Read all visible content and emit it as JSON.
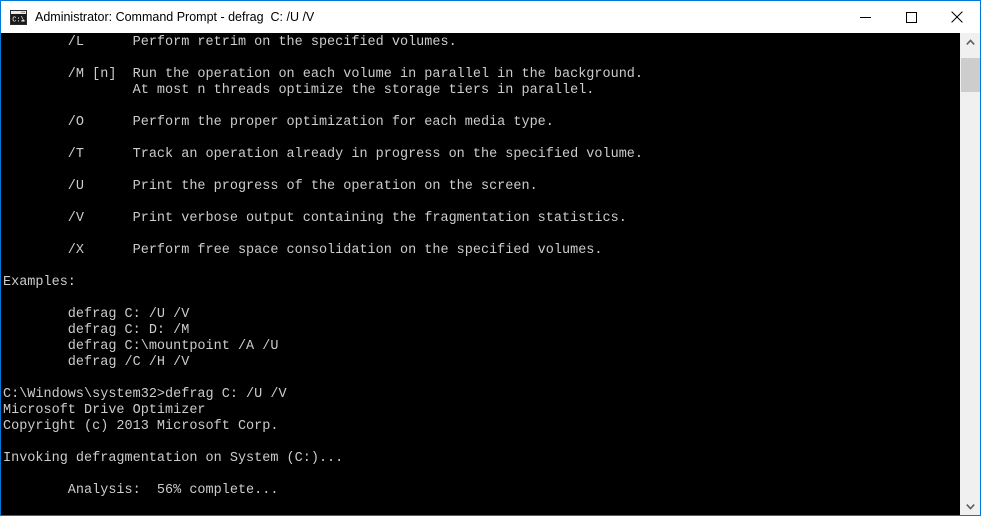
{
  "window": {
    "title": "Administrator: Command Prompt - defrag  C: /U /V",
    "icon_name": "command-prompt-icon",
    "accent_color": "#0078d7",
    "titlebar_background": "#ffffff",
    "console_background": "#000000",
    "console_foreground": "#cccccc"
  },
  "controls": {
    "minimize_glyph": "—",
    "maximize_glyph": "□",
    "close_glyph": "✕",
    "minimize_label": "Minimize",
    "maximize_label": "Maximize",
    "close_label": "Close"
  },
  "scrollbar": {
    "up_glyph": "∧",
    "down_glyph": "∨"
  },
  "console": {
    "lines": [
      "        /L      Perform retrim on the specified volumes.",
      "",
      "        /M [n]  Run the operation on each volume in parallel in the background.",
      "                At most n threads optimize the storage tiers in parallel.",
      "",
      "        /O      Perform the proper optimization for each media type.",
      "",
      "        /T      Track an operation already in progress on the specified volume.",
      "",
      "        /U      Print the progress of the operation on the screen.",
      "",
      "        /V      Print verbose output containing the fragmentation statistics.",
      "",
      "        /X      Perform free space consolidation on the specified volumes.",
      "",
      "Examples:",
      "",
      "        defrag C: /U /V",
      "        defrag C: D: /M",
      "        defrag C:\\mountpoint /A /U",
      "        defrag /C /H /V",
      "",
      "C:\\Windows\\system32>defrag C: /U /V",
      "Microsoft Drive Optimizer",
      "Copyright (c) 2013 Microsoft Corp.",
      "",
      "Invoking defragmentation on System (C:)...",
      "",
      "        Analysis:  56% complete..."
    ]
  }
}
